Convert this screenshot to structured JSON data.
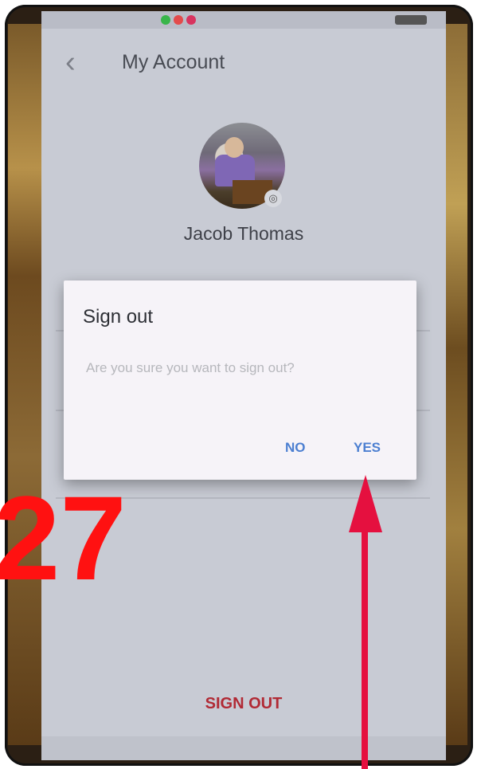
{
  "header": {
    "title": "My Account"
  },
  "profile": {
    "name": "Jacob Thomas"
  },
  "dialog": {
    "title": "Sign out",
    "message": "Are you sure you want to sign out?",
    "no_label": "NO",
    "yes_label": "YES"
  },
  "footer": {
    "sign_out_label": "SIGN OUT"
  },
  "overlay": {
    "step_number": "27"
  },
  "colors": {
    "accent": "#4c7fd1",
    "sign_out": "#b12a35",
    "annotation_number": "#ff1111",
    "annotation_arrow": "#e5103f"
  }
}
